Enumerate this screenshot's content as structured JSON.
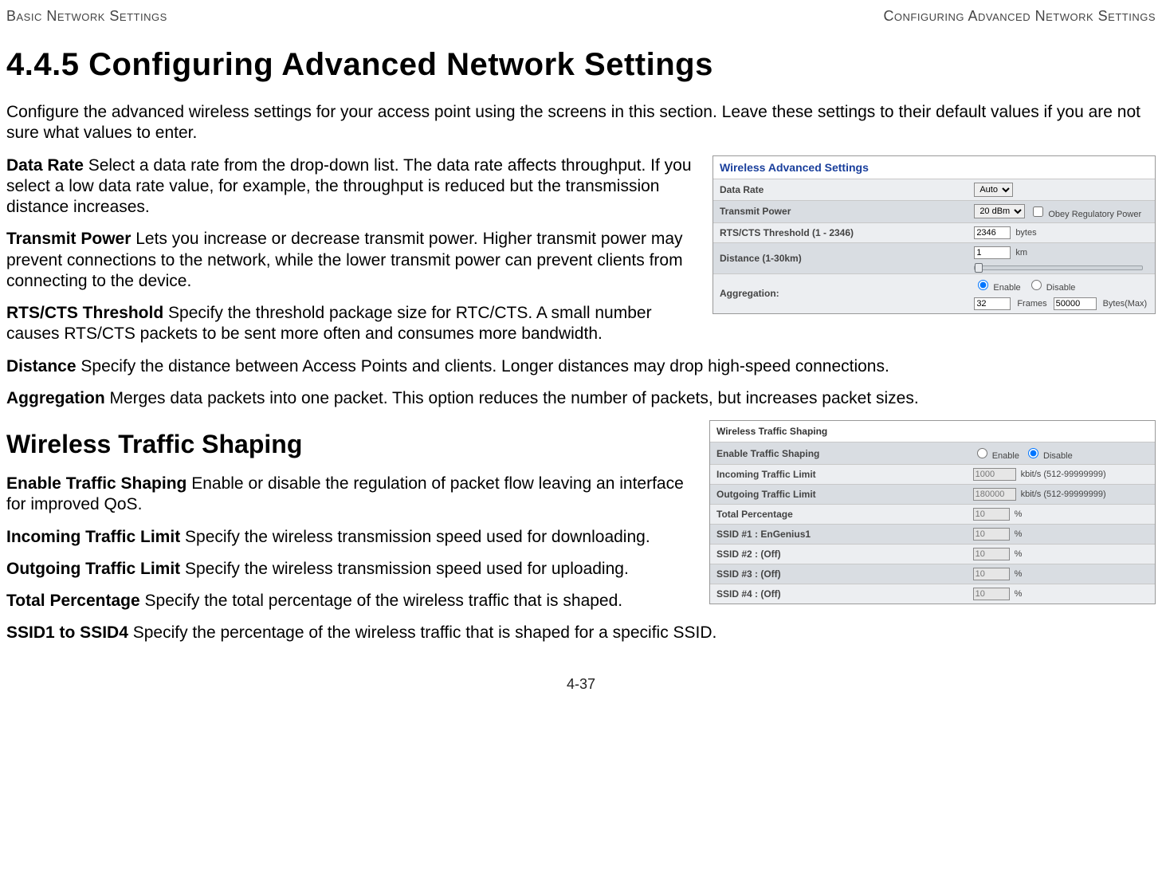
{
  "header": {
    "left": "Basic Network Settings",
    "right": "Configuring Advanced Network Settings"
  },
  "title": "4.4.5 Configuring Advanced Network Settings",
  "intro": "Configure the advanced wireless settings for your access point using the screens in this section. Leave these settings to their default values if you are not sure what values to enter.",
  "defs": {
    "data_rate_term": "Data Rate",
    "data_rate_text": "  Select a data rate from the drop-down list. The data rate affects throughput. If you select a low data rate value, for example, the throughput is reduced but the transmission distance increases.",
    "tx_power_term": "Transmit Power",
    "tx_power_text": "  Lets you increase or decrease transmit power. Higher transmit power may prevent connections to the network, while the lower transmit power can prevent clients from connecting to the device.",
    "rts_term": "RTS/CTS Threshold",
    "rts_text": "  Specify the threshold package size for RTC/CTS. A small number causes RTS/CTS packets to be sent more often and consumes more bandwidth.",
    "dist_term": "Distance",
    "dist_text": "  Specify the distance between Access Points and clients. Longer distances may drop high-speed connections.",
    "agg_term": "Aggregation",
    "agg_text": "  Merges data packets into one packet. This option reduces the number of packets, but increases packet sizes."
  },
  "sub_title": "Wireless Traffic Shaping",
  "shape": {
    "enable_term": "Enable Traffic Shaping",
    "enable_text": "  Enable or disable the regulation of packet flow leaving an interface for improved QoS.",
    "in_term": "Incoming Traffic Limit",
    "in_text": "  Specify the wireless transmission speed used for downloading.",
    "out_term": "Outgoing Traffic Limit",
    "out_text": "  Specify the wireless transmission speed used for uploading.",
    "tot_term": "Total Percentage",
    "tot_text": "  Specify the total percentage of the wireless traffic that is shaped.",
    "ssid_term": "SSID1 to SSID4",
    "ssid_text": "  Specify the percentage of the wireless traffic that is shaped for a specific SSID."
  },
  "fig1": {
    "title": "Wireless Advanced Settings",
    "rows": {
      "data_rate": {
        "label": "Data Rate",
        "value": "Auto"
      },
      "tx_power": {
        "label": "Transmit Power",
        "value": "20 dBm",
        "obey": "Obey Regulatory Power"
      },
      "rts": {
        "label": "RTS/CTS Threshold (1 - 2346)",
        "value": "2346",
        "unit": "bytes"
      },
      "distance": {
        "label": "Distance (1-30km)",
        "value": "1",
        "unit": "km"
      },
      "aggregation": {
        "label": "Aggregation:",
        "enable": "Enable",
        "disable": "Disable",
        "frames_val": "32",
        "frames_lbl": "Frames",
        "bytes_val": "50000",
        "bytes_lbl": "Bytes(Max)"
      }
    }
  },
  "fig2": {
    "title": "Wireless Traffic Shaping",
    "rows": {
      "enable": {
        "label": "Enable Traffic Shaping",
        "enable": "Enable",
        "disable": "Disable"
      },
      "incoming": {
        "label": "Incoming Traffic Limit",
        "value": "1000",
        "unit": "kbit/s (512-99999999)"
      },
      "outgoing": {
        "label": "Outgoing Traffic Limit",
        "value": "180000",
        "unit": "kbit/s (512-99999999)"
      },
      "total": {
        "label": "Total Percentage",
        "value": "10",
        "unit": "%"
      },
      "ssid1": {
        "label": "SSID #1 : EnGenius1",
        "value": "10",
        "unit": "%"
      },
      "ssid2": {
        "label": "SSID #2 : (Off)",
        "value": "10",
        "unit": "%"
      },
      "ssid3": {
        "label": "SSID #3 : (Off)",
        "value": "10",
        "unit": "%"
      },
      "ssid4": {
        "label": "SSID #4 : (Off)",
        "value": "10",
        "unit": "%"
      }
    }
  },
  "page_num": "4-37"
}
